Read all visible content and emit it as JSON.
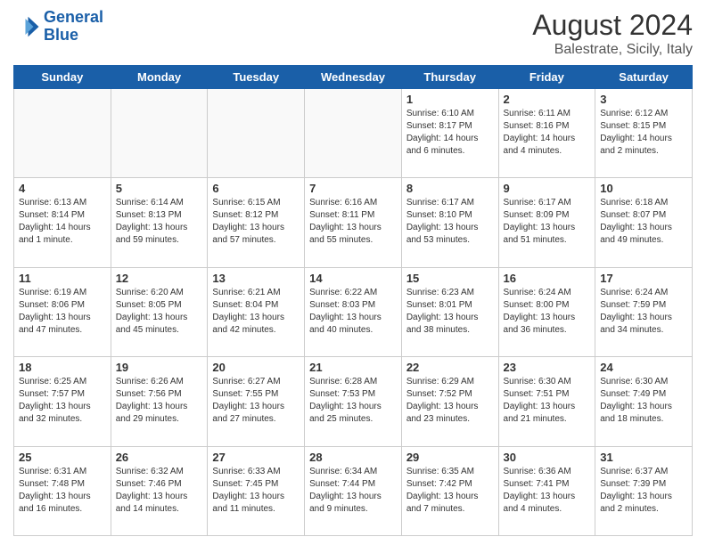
{
  "header": {
    "logo_line1": "General",
    "logo_line2": "Blue",
    "month_year": "August 2024",
    "location": "Balestrate, Sicily, Italy"
  },
  "days_of_week": [
    "Sunday",
    "Monday",
    "Tuesday",
    "Wednesday",
    "Thursday",
    "Friday",
    "Saturday"
  ],
  "weeks": [
    [
      {
        "day": "",
        "info": ""
      },
      {
        "day": "",
        "info": ""
      },
      {
        "day": "",
        "info": ""
      },
      {
        "day": "",
        "info": ""
      },
      {
        "day": "1",
        "info": "Sunrise: 6:10 AM\nSunset: 8:17 PM\nDaylight: 14 hours\nand 6 minutes."
      },
      {
        "day": "2",
        "info": "Sunrise: 6:11 AM\nSunset: 8:16 PM\nDaylight: 14 hours\nand 4 minutes."
      },
      {
        "day": "3",
        "info": "Sunrise: 6:12 AM\nSunset: 8:15 PM\nDaylight: 14 hours\nand 2 minutes."
      }
    ],
    [
      {
        "day": "4",
        "info": "Sunrise: 6:13 AM\nSunset: 8:14 PM\nDaylight: 14 hours\nand 1 minute."
      },
      {
        "day": "5",
        "info": "Sunrise: 6:14 AM\nSunset: 8:13 PM\nDaylight: 13 hours\nand 59 minutes."
      },
      {
        "day": "6",
        "info": "Sunrise: 6:15 AM\nSunset: 8:12 PM\nDaylight: 13 hours\nand 57 minutes."
      },
      {
        "day": "7",
        "info": "Sunrise: 6:16 AM\nSunset: 8:11 PM\nDaylight: 13 hours\nand 55 minutes."
      },
      {
        "day": "8",
        "info": "Sunrise: 6:17 AM\nSunset: 8:10 PM\nDaylight: 13 hours\nand 53 minutes."
      },
      {
        "day": "9",
        "info": "Sunrise: 6:17 AM\nSunset: 8:09 PM\nDaylight: 13 hours\nand 51 minutes."
      },
      {
        "day": "10",
        "info": "Sunrise: 6:18 AM\nSunset: 8:07 PM\nDaylight: 13 hours\nand 49 minutes."
      }
    ],
    [
      {
        "day": "11",
        "info": "Sunrise: 6:19 AM\nSunset: 8:06 PM\nDaylight: 13 hours\nand 47 minutes."
      },
      {
        "day": "12",
        "info": "Sunrise: 6:20 AM\nSunset: 8:05 PM\nDaylight: 13 hours\nand 45 minutes."
      },
      {
        "day": "13",
        "info": "Sunrise: 6:21 AM\nSunset: 8:04 PM\nDaylight: 13 hours\nand 42 minutes."
      },
      {
        "day": "14",
        "info": "Sunrise: 6:22 AM\nSunset: 8:03 PM\nDaylight: 13 hours\nand 40 minutes."
      },
      {
        "day": "15",
        "info": "Sunrise: 6:23 AM\nSunset: 8:01 PM\nDaylight: 13 hours\nand 38 minutes."
      },
      {
        "day": "16",
        "info": "Sunrise: 6:24 AM\nSunset: 8:00 PM\nDaylight: 13 hours\nand 36 minutes."
      },
      {
        "day": "17",
        "info": "Sunrise: 6:24 AM\nSunset: 7:59 PM\nDaylight: 13 hours\nand 34 minutes."
      }
    ],
    [
      {
        "day": "18",
        "info": "Sunrise: 6:25 AM\nSunset: 7:57 PM\nDaylight: 13 hours\nand 32 minutes."
      },
      {
        "day": "19",
        "info": "Sunrise: 6:26 AM\nSunset: 7:56 PM\nDaylight: 13 hours\nand 29 minutes."
      },
      {
        "day": "20",
        "info": "Sunrise: 6:27 AM\nSunset: 7:55 PM\nDaylight: 13 hours\nand 27 minutes."
      },
      {
        "day": "21",
        "info": "Sunrise: 6:28 AM\nSunset: 7:53 PM\nDaylight: 13 hours\nand 25 minutes."
      },
      {
        "day": "22",
        "info": "Sunrise: 6:29 AM\nSunset: 7:52 PM\nDaylight: 13 hours\nand 23 minutes."
      },
      {
        "day": "23",
        "info": "Sunrise: 6:30 AM\nSunset: 7:51 PM\nDaylight: 13 hours\nand 21 minutes."
      },
      {
        "day": "24",
        "info": "Sunrise: 6:30 AM\nSunset: 7:49 PM\nDaylight: 13 hours\nand 18 minutes."
      }
    ],
    [
      {
        "day": "25",
        "info": "Sunrise: 6:31 AM\nSunset: 7:48 PM\nDaylight: 13 hours\nand 16 minutes."
      },
      {
        "day": "26",
        "info": "Sunrise: 6:32 AM\nSunset: 7:46 PM\nDaylight: 13 hours\nand 14 minutes."
      },
      {
        "day": "27",
        "info": "Sunrise: 6:33 AM\nSunset: 7:45 PM\nDaylight: 13 hours\nand 11 minutes."
      },
      {
        "day": "28",
        "info": "Sunrise: 6:34 AM\nSunset: 7:44 PM\nDaylight: 13 hours\nand 9 minutes."
      },
      {
        "day": "29",
        "info": "Sunrise: 6:35 AM\nSunset: 7:42 PM\nDaylight: 13 hours\nand 7 minutes."
      },
      {
        "day": "30",
        "info": "Sunrise: 6:36 AM\nSunset: 7:41 PM\nDaylight: 13 hours\nand 4 minutes."
      },
      {
        "day": "31",
        "info": "Sunrise: 6:37 AM\nSunset: 7:39 PM\nDaylight: 13 hours\nand 2 minutes."
      }
    ]
  ]
}
